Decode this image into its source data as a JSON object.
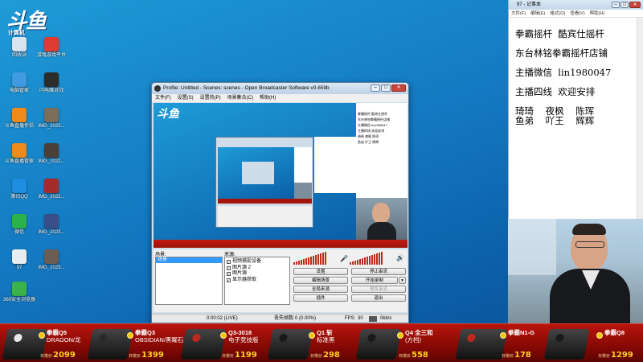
{
  "desktop": {
    "logo_text": "斗鱼",
    "logo_sub": "计算机",
    "icons": [
      {
        "label": "回收站",
        "color": "#d7e3ee"
      },
      {
        "label": "游戏游戏平台",
        "color": "#e03b2f"
      },
      {
        "label": "电脑管家",
        "color": "#3f9ae0"
      },
      {
        "label": "闪电魔对战",
        "color": "#2c2c2c"
      },
      {
        "label": "斗鱼直播伴侣",
        "color": "#f08a1a"
      },
      {
        "label": "IMG_2022...",
        "color": "#7a6d5a"
      },
      {
        "label": "斗鱼直播管家",
        "color": "#f08a1a"
      },
      {
        "label": "IMG_2022...",
        "color": "#4a4038"
      },
      {
        "label": "腾讯QQ",
        "color": "#1d8ee2"
      },
      {
        "label": "IMG_2022...",
        "color": "#a62a2a"
      },
      {
        "label": "微信",
        "color": "#2bb24c"
      },
      {
        "label": "IMG_2023...",
        "color": "#3a4f8a"
      },
      {
        "label": "97",
        "color": "#e8edf2"
      },
      {
        "label": "IMG_2023...",
        "color": "#6a5e54"
      },
      {
        "label": "360安全浏览器",
        "color": "#3cb24a"
      }
    ]
  },
  "obs": {
    "title": "Profile: Untitled - Scenes: scenes - Open Broadcaster Software v0.659b",
    "menu": [
      "文件(F)",
      "设置(S)",
      "设置热(P)",
      "场景集合(C)",
      "帮助(H)"
    ],
    "scenes_label": "场景:",
    "sources_label": "来源:",
    "selected_scene": "场景",
    "sources": [
      "视频捕捉设备",
      "图片源 2",
      "图片源",
      "显示器获取"
    ],
    "buttons": {
      "settings": "设置",
      "stop_stream": "停止串流",
      "edit_scene": "编辑场景",
      "start_record": "开始录制",
      "global_sources": "全局来源",
      "preview_stream": "预览串流",
      "plugins": "插件",
      "exit": "退出"
    },
    "status": {
      "time": "0:00:02 (LIVE)",
      "dropped_label": "丢失帧数:",
      "dropped_value": "0 (0.00%)",
      "fps_label": "FPS:",
      "fps_value": "30",
      "bitrate": "0kb/s"
    }
  },
  "notepad": {
    "title": "97 - 记事本",
    "menu": [
      "文件(F)",
      "编辑(E)",
      "格式(O)",
      "查看(V)",
      "帮助(H)"
    ],
    "lines": [
      "拳霸摇杆  酷宾仕摇杆",
      "东台林铭拳霸摇杆店铺",
      "主播微信  lin1980047",
      "主播四线  欢迎安排"
    ],
    "names": [
      "琦琦    夜枫    陈珲",
      "鱼弟    吖王    辉辉"
    ]
  },
  "banner": {
    "products": [
      {
        "name": "拳霸Q5",
        "sub": "DRAGON/龙",
        "price": "2099",
        "price_prefix": "日常价"
      },
      {
        "name": "拳霸Q3",
        "sub": "OBSIDIAN/黑曜石",
        "price": "1399",
        "price_prefix": "日常价"
      },
      {
        "name": "Q3-3018",
        "sub": "电子竞技版",
        "price": "1199",
        "price_prefix": "日常价"
      },
      {
        "name": "Q1 斩",
        "sub": "标准黑",
        "price": "298",
        "price_prefix": "日常价"
      },
      {
        "name": "Q4 全三和",
        "sub": "(方档)",
        "price": "558",
        "price_prefix": "日常价"
      },
      {
        "name": "拳霸N1-G",
        "sub": "",
        "price": "178",
        "price_prefix": "日常价"
      },
      {
        "name": "拳霸Q8",
        "sub": "",
        "price": "1299",
        "price_prefix": "日常价"
      }
    ]
  },
  "colors": {
    "desktop_blue": "#1479c2",
    "banner_red": "#b8140c",
    "price_yellow": "#ffd21a",
    "selection_blue": "#3399ff",
    "meter_red": "#c0281d"
  }
}
